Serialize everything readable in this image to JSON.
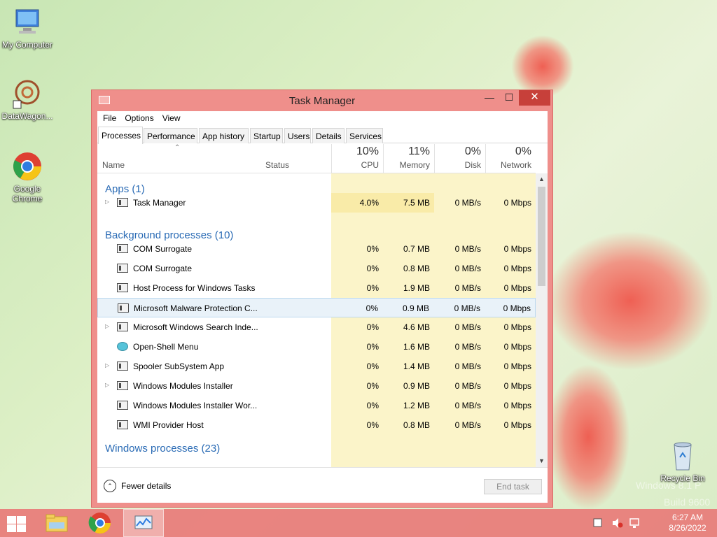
{
  "desktop": {
    "icons": [
      {
        "label": "My Computer"
      },
      {
        "label": "DataWagon..."
      },
      {
        "label": "Google Chrome"
      }
    ],
    "recycle_bin": {
      "label": "Recycle Bin"
    },
    "watermark": {
      "line1": "Windows 8.1 P",
      "line2": "Build 9600"
    }
  },
  "window": {
    "title": "Task Manager",
    "minimize": "—",
    "maximize": "☐",
    "close": "✕"
  },
  "menu": {
    "file": "File",
    "options": "Options",
    "view": "View"
  },
  "tabs": [
    "Processes",
    "Performance",
    "App history",
    "Startup",
    "Users",
    "Details",
    "Services"
  ],
  "columns": {
    "name": "Name",
    "status": "Status",
    "cpu": {
      "pct": "10%",
      "label": "CPU"
    },
    "memory": {
      "pct": "11%",
      "label": "Memory"
    },
    "disk": {
      "pct": "0%",
      "label": "Disk"
    },
    "network": {
      "pct": "0%",
      "label": "Network"
    }
  },
  "groups": {
    "apps": "Apps (1)",
    "background": "Background processes (10)",
    "windows": "Windows processes (23)"
  },
  "apps": [
    {
      "name": "Task Manager",
      "cpu": "4.0%",
      "memory": "7.5 MB",
      "disk": "0 MB/s",
      "network": "0 Mbps"
    }
  ],
  "background": [
    {
      "name": "COM Surrogate",
      "cpu": "0%",
      "memory": "0.7 MB",
      "disk": "0 MB/s",
      "network": "0 Mbps"
    },
    {
      "name": "COM Surrogate",
      "cpu": "0%",
      "memory": "0.8 MB",
      "disk": "0 MB/s",
      "network": "0 Mbps"
    },
    {
      "name": "Host Process for Windows Tasks",
      "cpu": "0%",
      "memory": "1.9 MB",
      "disk": "0 MB/s",
      "network": "0 Mbps"
    },
    {
      "name": "Microsoft Malware Protection C...",
      "cpu": "0%",
      "memory": "0.9 MB",
      "disk": "0 MB/s",
      "network": "0 Mbps"
    },
    {
      "name": "Microsoft Windows Search Inde...",
      "cpu": "0%",
      "memory": "4.6 MB",
      "disk": "0 MB/s",
      "network": "0 Mbps"
    },
    {
      "name": "Open-Shell Menu",
      "cpu": "0%",
      "memory": "1.6 MB",
      "disk": "0 MB/s",
      "network": "0 Mbps"
    },
    {
      "name": "Spooler SubSystem App",
      "cpu": "0%",
      "memory": "1.4 MB",
      "disk": "0 MB/s",
      "network": "0 Mbps"
    },
    {
      "name": "Windows Modules Installer",
      "cpu": "0%",
      "memory": "0.9 MB",
      "disk": "0 MB/s",
      "network": "0 Mbps"
    },
    {
      "name": "Windows Modules Installer Wor...",
      "cpu": "0%",
      "memory": "1.2 MB",
      "disk": "0 MB/s",
      "network": "0 Mbps"
    },
    {
      "name": "WMI Provider Host",
      "cpu": "0%",
      "memory": "0.8 MB",
      "disk": "0 MB/s",
      "network": "0 Mbps"
    }
  ],
  "footer": {
    "fewer_details": "Fewer details",
    "end_task": "End task"
  },
  "taskbar": {
    "time": "6:27 AM",
    "date": "8/26/2022"
  },
  "colors": {
    "accent": "#ef8f8b",
    "group_text": "#2a6bb5",
    "cpu_tint": "#fbf4c9",
    "selected_row": "#e9f2f9"
  }
}
